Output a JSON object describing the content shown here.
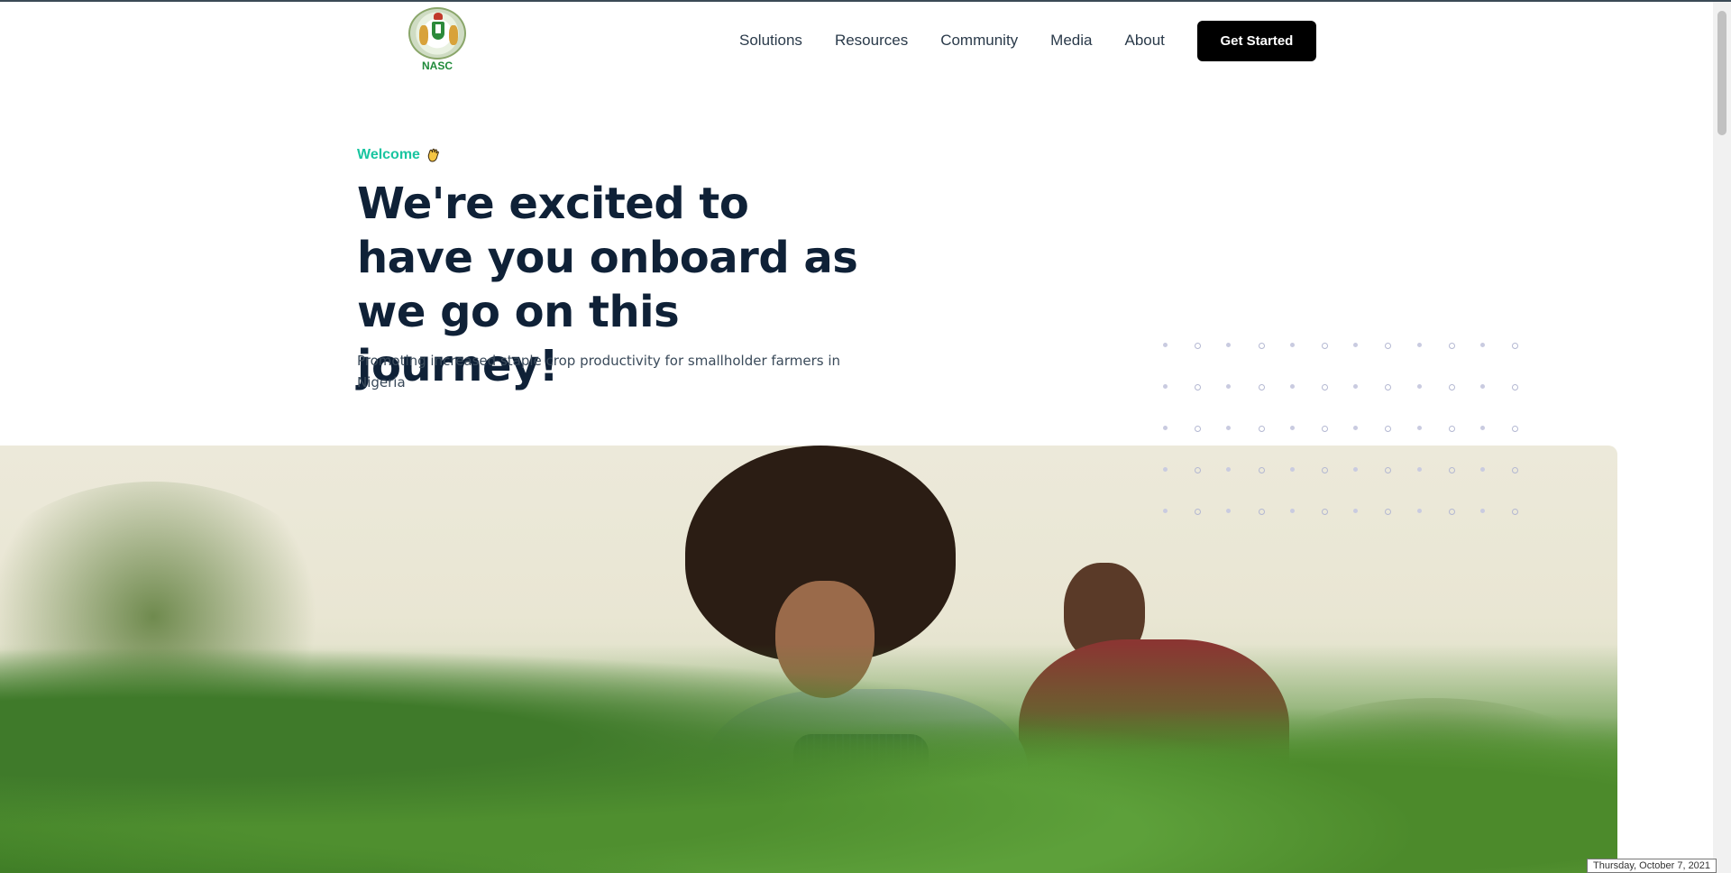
{
  "header": {
    "logo_text": "NASC",
    "nav": [
      "Solutions",
      "Resources",
      "Community",
      "Media",
      "About"
    ],
    "cta_label": "Get Started"
  },
  "hero": {
    "welcome": "Welcome",
    "headline": "We're excited to have you onboard as we go on this journey!",
    "subtext": "Promoting increased staple crop productivity for smallholder farmers in Nigeria"
  },
  "icons": {
    "wave": "waving-hand-icon",
    "logo": "nasc-coat-of-arms-emblem"
  },
  "colors": {
    "accent": "#19c5a0",
    "heading": "#0f2137",
    "cta_bg": "#000000",
    "logo_green": "#1f8a3a"
  },
  "status": {
    "date": "Thursday, October 7, 2021"
  }
}
